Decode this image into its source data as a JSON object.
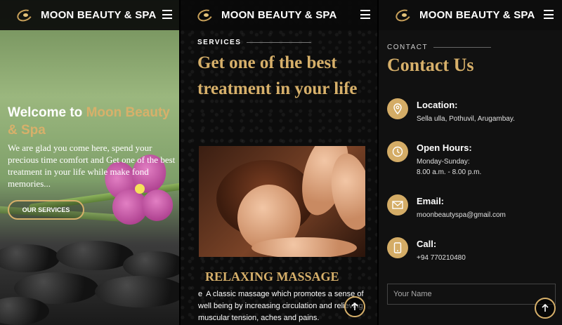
{
  "brand": {
    "name": "MOON BEAUTY & SPA"
  },
  "colors": {
    "accent": "#d7b06a",
    "background": "#0b0b0b"
  },
  "icons": {
    "logo": "moon-logo-icon",
    "menu": "hamburger-menu-icon",
    "scroll_top": "arrow-up-icon"
  },
  "home": {
    "welcome_prefix": "Welcome to",
    "welcome_highlight": "Moon Beauty & Spa",
    "description": "We are glad you come here, spend your precious time comfort and Get one of the best treatment in your life while make fond memories...",
    "cta_label": "OUR SERVICES"
  },
  "services": {
    "label": "SERVICES",
    "title": "Get one of the best treatment in your life",
    "card": {
      "title": "RELAXING MASSAGE",
      "bullet": "e",
      "text": "A classic massage which promotes a sense of well being by increasing circulation and relieving muscular tension, aches and pains."
    }
  },
  "contact": {
    "label": "CONTACT",
    "title": "Contact Us",
    "location": {
      "heading": "Location:",
      "value": "Sella ulla, Pothuvil, Arugambay."
    },
    "hours": {
      "heading": "Open Hours:",
      "line1": "Monday-Sunday:",
      "line2": "8.00 a.m. - 8.00 p.m."
    },
    "email": {
      "heading": "Email:",
      "value": "moonbeautyspa@gmail.com"
    },
    "call": {
      "heading": "Call:",
      "value": "+94 770210480"
    },
    "name_placeholder": "Your Name"
  }
}
